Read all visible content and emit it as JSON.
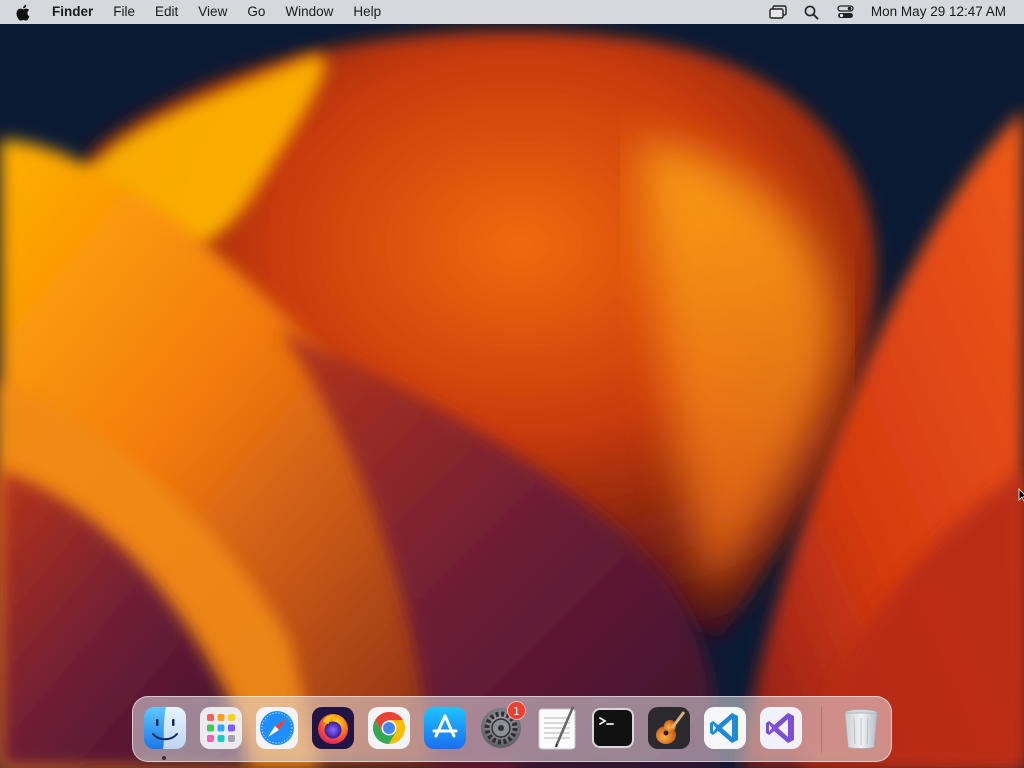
{
  "menubar": {
    "app_name": "Finder",
    "menus": [
      "File",
      "Edit",
      "View",
      "Go",
      "Window",
      "Help"
    ],
    "clock": "Mon May 29  12:47 AM",
    "status_icons": [
      "screen-mirroring-icon",
      "spotlight-search-icon",
      "control-center-icon"
    ]
  },
  "dock": {
    "apps": [
      {
        "name": "Finder",
        "icon": "finder-icon",
        "running": true
      },
      {
        "name": "Launchpad",
        "icon": "launchpad-icon"
      },
      {
        "name": "Safari",
        "icon": "safari-icon"
      },
      {
        "name": "Firefox",
        "icon": "firefox-icon"
      },
      {
        "name": "Google Chrome",
        "icon": "chrome-icon"
      },
      {
        "name": "App Store",
        "icon": "app-store-icon"
      },
      {
        "name": "System Settings",
        "icon": "system-settings-icon",
        "badge": "1"
      },
      {
        "name": "TextEdit",
        "icon": "textedit-icon"
      },
      {
        "name": "Terminal",
        "icon": "terminal-icon"
      },
      {
        "name": "GarageBand",
        "icon": "garageband-icon"
      },
      {
        "name": "Visual Studio Code",
        "icon": "vscode-icon"
      },
      {
        "name": "Visual Studio",
        "icon": "visual-studio-icon"
      },
      {
        "name": "Trash",
        "icon": "trash-icon"
      }
    ]
  },
  "colors": {
    "wallpaper_dark": "#0b1a33",
    "wallpaper_orange": "#f26a10",
    "wallpaper_yellow": "#ffb000",
    "wallpaper_purple": "#5a1a3a",
    "badge_red": "#ee3e33"
  }
}
